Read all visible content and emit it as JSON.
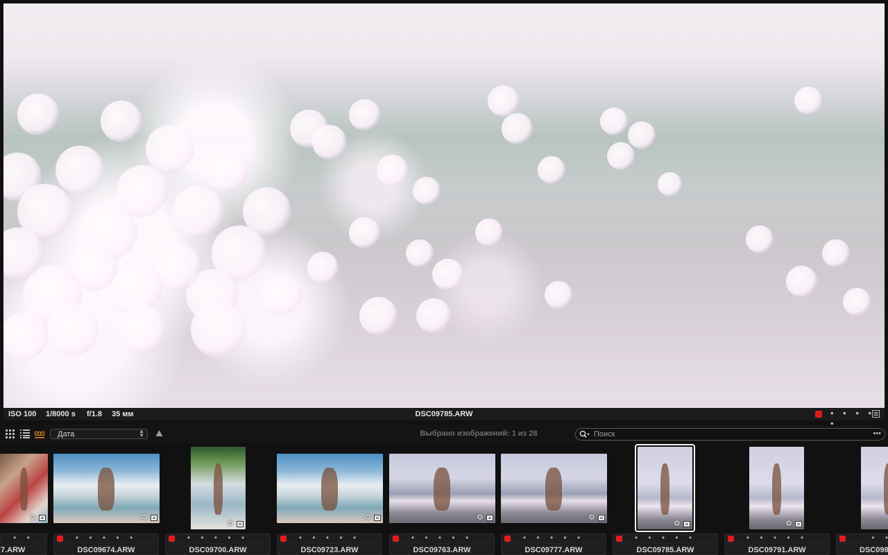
{
  "viewer": {
    "iso": "ISO 100",
    "shutter": "1/8000 s",
    "aperture": "f/1.8",
    "focal": "35 мм",
    "filename": "DSC09785.ARW",
    "stars": "• • • • •",
    "label_color": "#e01b1b"
  },
  "toolbar": {
    "view_icons": [
      "grid-view-icon",
      "list-view-icon",
      "filmstrip-view-icon"
    ],
    "sort_value": "Дата",
    "sort_direction_icon": "triangle-up-icon",
    "selection_status": "Выбрано изображений: 1 из 28",
    "search_placeholder": "Поиск",
    "search_more": "•••"
  },
  "filmstrip": {
    "items": [
      {
        "name": "7.ARW",
        "stars": "• •",
        "label": "red",
        "selected": false
      },
      {
        "name": "DSC09674.ARW",
        "stars": "• • • • •",
        "label": "red",
        "selected": false
      },
      {
        "name": "DSC09700.ARW",
        "stars": "• • • • •",
        "label": "red",
        "selected": false
      },
      {
        "name": "DSC09723.ARW",
        "stars": "• • • • •",
        "label": "red",
        "selected": false
      },
      {
        "name": "DSC09763.ARW",
        "stars": "• • • • •",
        "label": "red",
        "selected": false
      },
      {
        "name": "DSC09777.ARW",
        "stars": "• • • • •",
        "label": "red",
        "selected": false
      },
      {
        "name": "DSC09785.ARW",
        "stars": "• • • • •",
        "label": "red",
        "selected": true
      },
      {
        "name": "DSC09791.ARW",
        "stars": "• • • • •",
        "label": "red",
        "selected": false
      },
      {
        "name": "DSC098",
        "stars": "• • •",
        "label": "red",
        "selected": false
      }
    ]
  },
  "colors": {
    "background": "#111112",
    "panel": "#1e1e1f",
    "label_red": "#e01b1b",
    "selection_border": "#f4f4f4"
  }
}
